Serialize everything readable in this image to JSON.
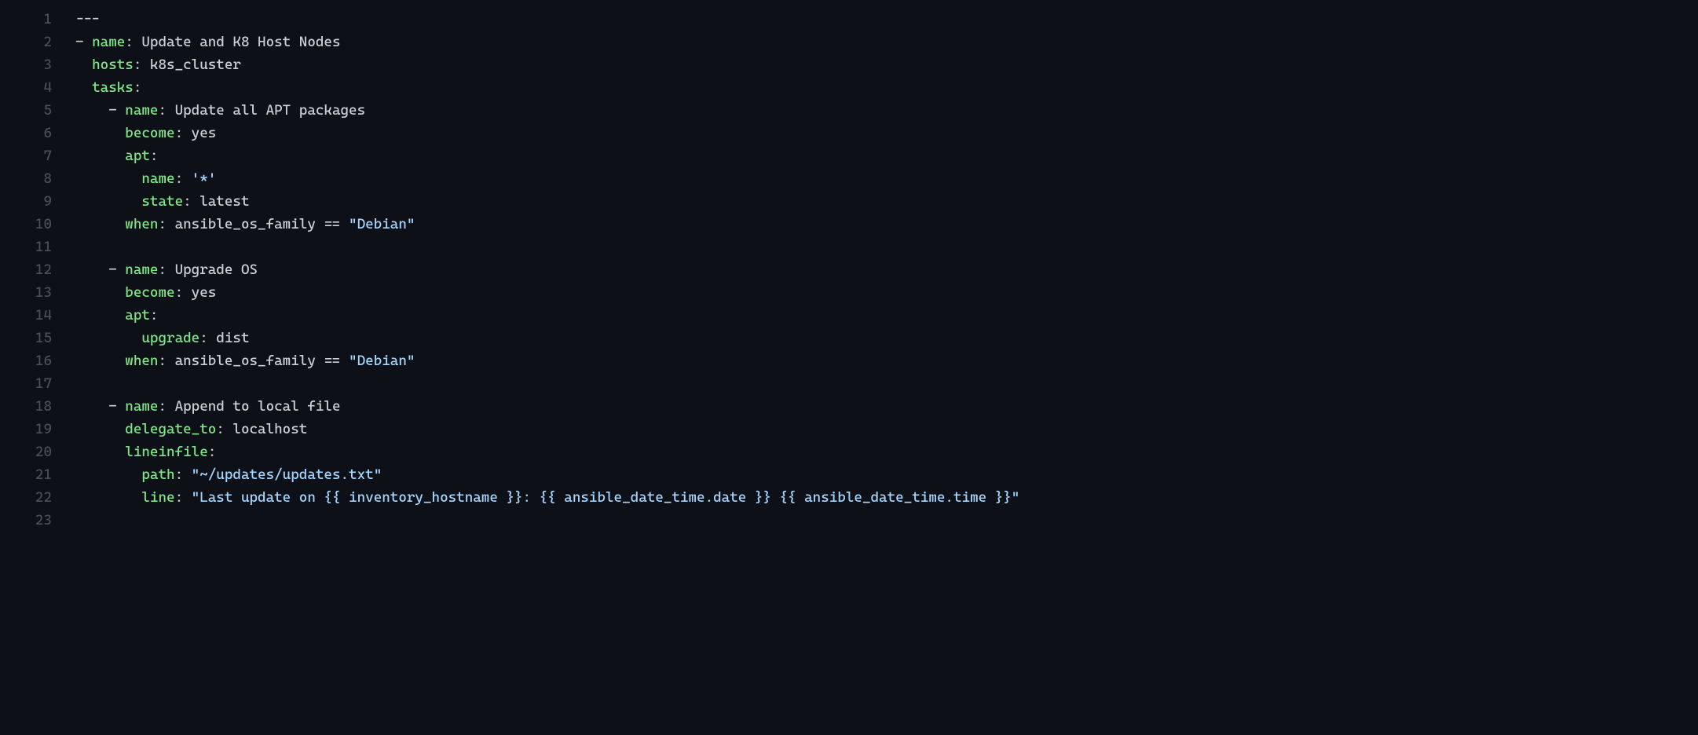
{
  "lines": [
    {
      "num": "1",
      "segments": [
        {
          "t": "---",
          "c": "plain"
        }
      ]
    },
    {
      "num": "2",
      "segments": [
        {
          "t": "- ",
          "c": "punct"
        },
        {
          "t": "name",
          "c": "key"
        },
        {
          "t": ": ",
          "c": "punct"
        },
        {
          "t": "Update and K8 Host Nodes",
          "c": "plain"
        }
      ]
    },
    {
      "num": "3",
      "segments": [
        {
          "t": "  ",
          "c": "punct"
        },
        {
          "t": "hosts",
          "c": "key"
        },
        {
          "t": ": ",
          "c": "punct"
        },
        {
          "t": "k8s_cluster",
          "c": "plain"
        }
      ]
    },
    {
      "num": "4",
      "segments": [
        {
          "t": "  ",
          "c": "punct"
        },
        {
          "t": "tasks",
          "c": "key"
        },
        {
          "t": ":",
          "c": "punct"
        }
      ]
    },
    {
      "num": "5",
      "segments": [
        {
          "t": "    - ",
          "c": "punct"
        },
        {
          "t": "name",
          "c": "key"
        },
        {
          "t": ": ",
          "c": "punct"
        },
        {
          "t": "Update all APT packages",
          "c": "plain"
        }
      ]
    },
    {
      "num": "6",
      "segments": [
        {
          "t": "      ",
          "c": "punct"
        },
        {
          "t": "become",
          "c": "key"
        },
        {
          "t": ": ",
          "c": "punct"
        },
        {
          "t": "yes",
          "c": "plain"
        }
      ]
    },
    {
      "num": "7",
      "segments": [
        {
          "t": "      ",
          "c": "punct"
        },
        {
          "t": "apt",
          "c": "key"
        },
        {
          "t": ":",
          "c": "punct"
        }
      ]
    },
    {
      "num": "8",
      "segments": [
        {
          "t": "        ",
          "c": "punct"
        },
        {
          "t": "name",
          "c": "key"
        },
        {
          "t": ": ",
          "c": "punct"
        },
        {
          "t": "'*'",
          "c": "string"
        }
      ]
    },
    {
      "num": "9",
      "segments": [
        {
          "t": "        ",
          "c": "punct"
        },
        {
          "t": "state",
          "c": "key"
        },
        {
          "t": ": ",
          "c": "punct"
        },
        {
          "t": "latest",
          "c": "plain"
        }
      ]
    },
    {
      "num": "10",
      "segments": [
        {
          "t": "      ",
          "c": "punct"
        },
        {
          "t": "when",
          "c": "key"
        },
        {
          "t": ": ",
          "c": "punct"
        },
        {
          "t": "ansible_os_family == ",
          "c": "plain"
        },
        {
          "t": "\"Debian\"",
          "c": "string"
        }
      ]
    },
    {
      "num": "11",
      "segments": [
        {
          "t": "",
          "c": "plain"
        }
      ]
    },
    {
      "num": "12",
      "segments": [
        {
          "t": "    - ",
          "c": "punct"
        },
        {
          "t": "name",
          "c": "key"
        },
        {
          "t": ": ",
          "c": "punct"
        },
        {
          "t": "Upgrade OS",
          "c": "plain"
        }
      ]
    },
    {
      "num": "13",
      "segments": [
        {
          "t": "      ",
          "c": "punct"
        },
        {
          "t": "become",
          "c": "key"
        },
        {
          "t": ": ",
          "c": "punct"
        },
        {
          "t": "yes",
          "c": "plain"
        }
      ]
    },
    {
      "num": "14",
      "segments": [
        {
          "t": "      ",
          "c": "punct"
        },
        {
          "t": "apt",
          "c": "key"
        },
        {
          "t": ":",
          "c": "punct"
        }
      ]
    },
    {
      "num": "15",
      "segments": [
        {
          "t": "        ",
          "c": "punct"
        },
        {
          "t": "upgrade",
          "c": "key"
        },
        {
          "t": ": ",
          "c": "punct"
        },
        {
          "t": "dist",
          "c": "plain"
        }
      ]
    },
    {
      "num": "16",
      "segments": [
        {
          "t": "      ",
          "c": "punct"
        },
        {
          "t": "when",
          "c": "key"
        },
        {
          "t": ": ",
          "c": "punct"
        },
        {
          "t": "ansible_os_family == ",
          "c": "plain"
        },
        {
          "t": "\"Debian\"",
          "c": "string"
        }
      ]
    },
    {
      "num": "17",
      "segments": [
        {
          "t": "",
          "c": "plain"
        }
      ]
    },
    {
      "num": "18",
      "segments": [
        {
          "t": "    - ",
          "c": "punct"
        },
        {
          "t": "name",
          "c": "key"
        },
        {
          "t": ": ",
          "c": "punct"
        },
        {
          "t": "Append to local file",
          "c": "plain"
        }
      ]
    },
    {
      "num": "19",
      "segments": [
        {
          "t": "      ",
          "c": "punct"
        },
        {
          "t": "delegate_to",
          "c": "key"
        },
        {
          "t": ": ",
          "c": "punct"
        },
        {
          "t": "localhost",
          "c": "plain"
        }
      ]
    },
    {
      "num": "20",
      "segments": [
        {
          "t": "      ",
          "c": "punct"
        },
        {
          "t": "lineinfile",
          "c": "key"
        },
        {
          "t": ":",
          "c": "punct"
        }
      ]
    },
    {
      "num": "21",
      "segments": [
        {
          "t": "        ",
          "c": "punct"
        },
        {
          "t": "path",
          "c": "key"
        },
        {
          "t": ": ",
          "c": "punct"
        },
        {
          "t": "\"~/updates/updates.txt\"",
          "c": "string"
        }
      ]
    },
    {
      "num": "22",
      "segments": [
        {
          "t": "        ",
          "c": "punct"
        },
        {
          "t": "line",
          "c": "key"
        },
        {
          "t": ": ",
          "c": "punct"
        },
        {
          "t": "\"Last update on {{ inventory_hostname }}: {{ ansible_date_time.date }} {{ ansible_date_time.time }}\"",
          "c": "string"
        }
      ]
    },
    {
      "num": "23",
      "segments": [
        {
          "t": "",
          "c": "plain"
        }
      ]
    }
  ]
}
